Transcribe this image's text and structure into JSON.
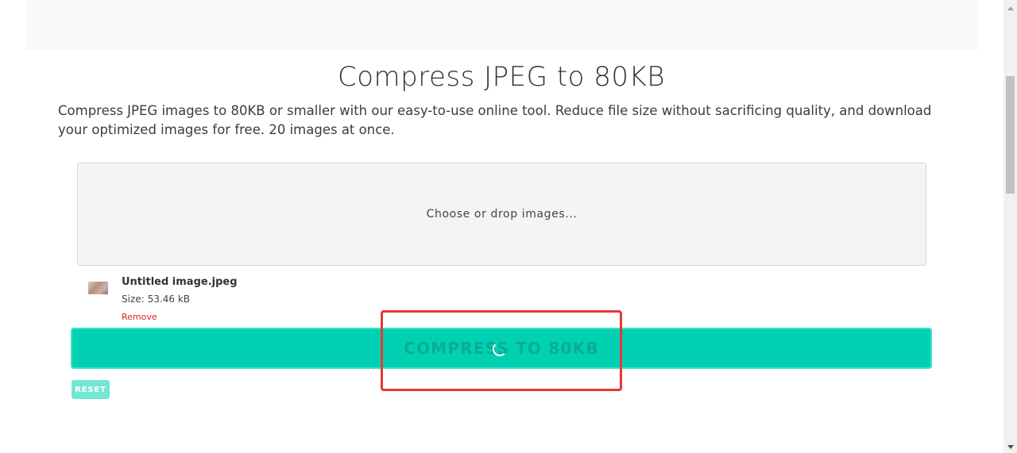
{
  "page": {
    "title": "Compress JPEG to 80KB",
    "description": "Compress JPEG images to 80KB or smaller with our easy-to-use online tool. Reduce file size without sacrificing quality, and download your optimized images for free. 20 images at once."
  },
  "dropzone": {
    "label": "Choose or drop images..."
  },
  "file": {
    "name": "Untitled image.jpeg",
    "size_label": "Size:",
    "size_value": "53.46 kB",
    "remove_label": "Remove"
  },
  "actions": {
    "compress_label": "COMPRESS TO 80KB",
    "reset_label": "RESET"
  },
  "state": {
    "compress_loading": true
  },
  "colors": {
    "accent": "#00d1b2",
    "reset_bg": "#73e6d3",
    "remove_link": "#e0201f",
    "highlight": "#e53935"
  },
  "icons": {
    "spinner": "loading-spinner-icon",
    "thumbnail": "image-thumbnail"
  }
}
